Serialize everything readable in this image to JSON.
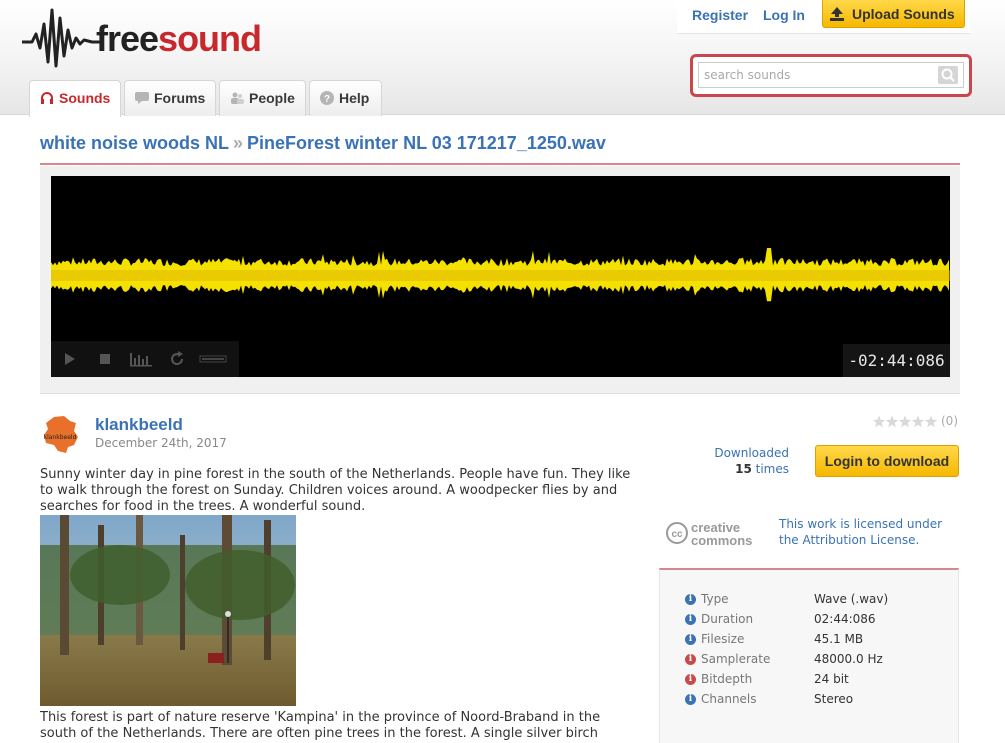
{
  "logo": {
    "free": "free",
    "sound": "sound"
  },
  "header": {
    "register": "Register",
    "login": "Log In",
    "upload": "Upload Sounds",
    "search_placeholder": "search sounds"
  },
  "tabs": [
    {
      "label": "Sounds",
      "icon": "headphones-icon"
    },
    {
      "label": "Forums",
      "icon": "speech-bubble-icon"
    },
    {
      "label": "People",
      "icon": "people-icon"
    },
    {
      "label": "Help",
      "icon": "help-icon"
    }
  ],
  "breadcrumb": {
    "pack": "white noise woods NL",
    "separator": "»",
    "sound": "PineForest winter NL 03 171217_1250.wav"
  },
  "player": {
    "time": "-02:44:086",
    "waveform_color": "#f5e100"
  },
  "author": {
    "name": "klankbeeld",
    "date": "December 24th, 2017",
    "avatar_text": "klankbeeld"
  },
  "description": {
    "para1": "Sunny winter day in pine forest in the south of the Netherlands. People have fun. They like to walk through the forest on Sunday. Children voices around. A woodpecker flies by and searches for food in the trees. A wonderful sound.",
    "para2": "This forest is part of nature reserve 'Kampina' in the province of Noord-Braband in the south of the Netherlands. There are often pine trees in the forest. A single silver birch"
  },
  "rating": {
    "stars": 0,
    "count": "(0)"
  },
  "downloads": {
    "label": "Downloaded",
    "count": "15",
    "suffix": "times"
  },
  "login_download": "Login to download",
  "license": {
    "logo_top": "creative",
    "logo_bottom": "commons",
    "text": "This work is licensed under the Attribution License."
  },
  "properties": [
    {
      "label": "Type",
      "value": "Wave (.wav)",
      "icon_color": "blue"
    },
    {
      "label": "Duration",
      "value": "02:44:086",
      "icon_color": "blue"
    },
    {
      "label": "Filesize",
      "value": "45.1 MB",
      "icon_color": "blue"
    },
    {
      "label": "Samplerate",
      "value": "48000.0 Hz",
      "icon_color": "red"
    },
    {
      "label": "Bitdepth",
      "value": "24 bit",
      "icon_color": "red"
    },
    {
      "label": "Channels",
      "value": "Stereo",
      "icon_color": "blue"
    }
  ],
  "colors": {
    "brand_red": "#c7282b",
    "link_blue": "#3a72b6",
    "button_yellow": "#f6b800"
  }
}
